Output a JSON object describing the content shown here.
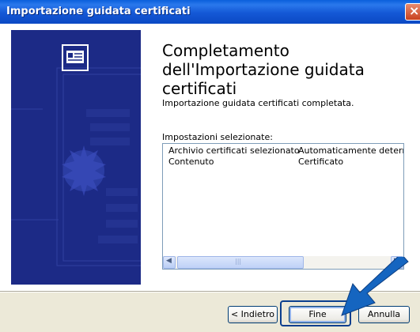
{
  "window": {
    "title": "Importazione guidata certificati",
    "close_glyph": "×"
  },
  "page": {
    "heading": "Completamento dell'Importazione guidata certificati",
    "description": "Importazione guidata certificati completata.",
    "settings_label": "Impostazioni selezionate:"
  },
  "settings": {
    "rows": [
      {
        "name": "Archivio certificati selezionato",
        "value": "Automaticamente determi"
      },
      {
        "name": "Contenuto",
        "value": "Certificato"
      }
    ]
  },
  "buttons": {
    "back": "< Indietro",
    "finish": "Fine",
    "cancel": "Annulla"
  },
  "icons": {
    "close": "close-icon",
    "wizard": "certificate-icon",
    "scroll_left": "scroll-left-icon",
    "scroll_right": "scroll-right-icon",
    "annotation_arrow": "pointer-arrow-icon"
  },
  "colors": {
    "titlebar": "#0b49c4",
    "banner": "#1c2a86",
    "arrow": "#1565c0"
  }
}
